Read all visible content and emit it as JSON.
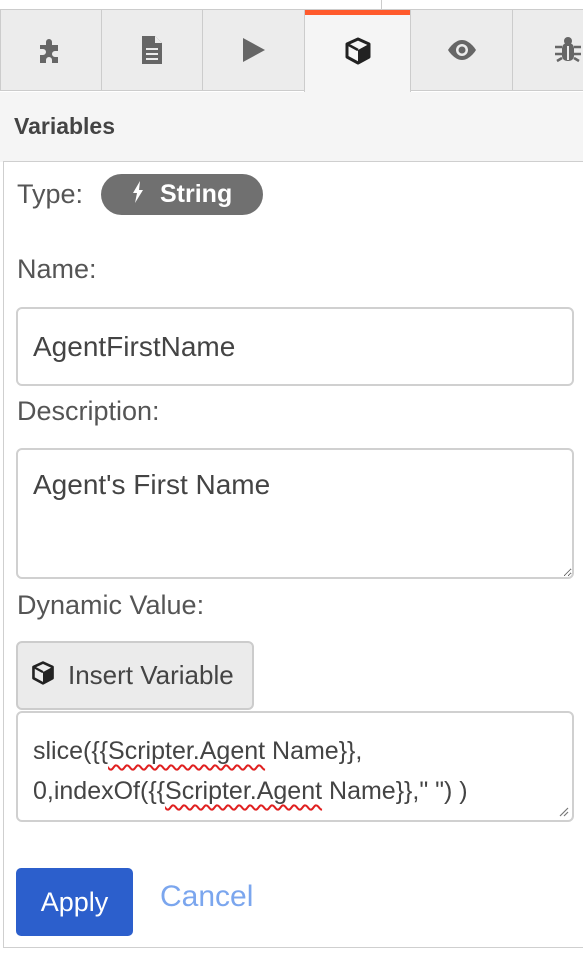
{
  "tabs": [
    {
      "icon": "puzzle-icon"
    },
    {
      "icon": "document-icon"
    },
    {
      "icon": "play-icon"
    },
    {
      "icon": "cube-icon",
      "active": true
    },
    {
      "icon": "eye-icon"
    },
    {
      "icon": "bug-icon"
    }
  ],
  "section": {
    "title": "Variables"
  },
  "form": {
    "type_label": "Type:",
    "type_value": "String",
    "type_icon": "bolt-icon",
    "name_label": "Name:",
    "name_value": "AgentFirstName",
    "description_label": "Description:",
    "description_value": "Agent's First Name",
    "dynamic_label": "Dynamic Value:",
    "insert_variable_label": "Insert Variable",
    "dynamic_value": {
      "line1_pre": "slice({{",
      "line1_misspelled": "Scripter.Agent",
      "line1_post": " Name}},",
      "line2_pre": "0,indexOf({{",
      "line2_misspelled": "Scripter.Agent",
      "line2_post": " Name}},\" \") )"
    }
  },
  "actions": {
    "apply": "Apply",
    "cancel": "Cancel"
  },
  "colors": {
    "accent_tab": "#ff5a2c",
    "apply_bg": "#2c5fcc",
    "cancel_link": "#7ba6ee",
    "badge_bg": "#707070",
    "spellcheck": "#e02020"
  }
}
